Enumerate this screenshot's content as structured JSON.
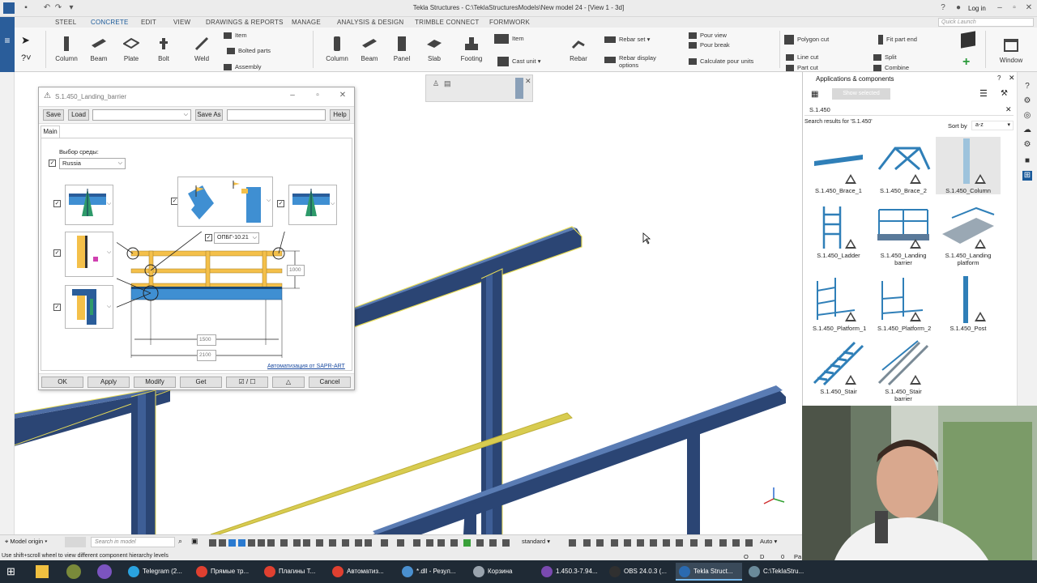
{
  "window": {
    "title": "Tekla Structures - C:\\TeklaStructuresModels\\New model 24 - [View 1 - 3d]",
    "login": "Log in",
    "quick_launch": "Quick Launch"
  },
  "tabs": [
    "STEEL",
    "CONCRETE",
    "EDIT",
    "VIEW",
    "DRAWINGS & REPORTS",
    "MANAGE",
    "ANALYSIS & DESIGN",
    "TRIMBLE CONNECT",
    "FORMWORK"
  ],
  "ribbon": {
    "steel": {
      "column": "Column",
      "beam": "Beam",
      "plate": "Plate",
      "bolt": "Bolt",
      "weld": "Weld",
      "item": "Item",
      "bolted_parts": "Bolted parts",
      "assembly": "Assembly"
    },
    "concrete": {
      "column": "Column",
      "beam": "Beam",
      "panel": "Panel",
      "slab": "Slab",
      "footing": "Footing",
      "item": "Item",
      "cast_unit": "Cast unit",
      "rebar": "Rebar",
      "rebar_set": "Rebar set",
      "rebar_display": "Rebar display options",
      "pour_view": "Pour view",
      "pour_break": "Pour break",
      "calculate_pour": "Calculate pour units"
    },
    "edit": {
      "polygon_cut": "Polygon cut",
      "line_cut": "Line cut",
      "part_cut": "Part cut",
      "fit_part_end": "Fit part end",
      "split": "Split",
      "combine": "Combine"
    },
    "window": "Window"
  },
  "dialog": {
    "title": "S.1.450_Landing_barrier",
    "save": "Save",
    "load": "Load",
    "save_as": "Save As",
    "help": "Help",
    "tab_main": "Main",
    "env_label": "Выбор среды:",
    "env_value": "Russia",
    "profile_value": "ОПБГ-10.21",
    "dim_height": "1000",
    "dim_inner": "1500",
    "dim_outer": "2100",
    "link": "Автоматизация от SAPR-ART",
    "ok": "OK",
    "apply": "Apply",
    "modify": "Modify",
    "get": "Get",
    "toggle": "☑ / ☐",
    "warn": "△",
    "cancel": "Cancel"
  },
  "apps": {
    "title": "Applications & components",
    "show_selected": "Show selected",
    "search_value": "S.1.450",
    "results_label": "Search results for 'S.1.450'",
    "sort_label": "Sort by",
    "sort_value": "a-z",
    "items": [
      "S.1.450_Brace_1",
      "S.1.450_Brace_2",
      "S.1.450_Column",
      "S.1.450_Ladder",
      "S.1.450_Landing barrier",
      "S.1.450_Landing platform",
      "S.1.450_Platform_1",
      "S.1.450_Platform_2",
      "S.1.450_Post",
      "S.1.450_Stair",
      "S.1.450_Stair barrier"
    ]
  },
  "statusbar": {
    "model_origin": "Model origin",
    "search_placeholder": "Search in model",
    "standard": "standard",
    "auto": "Auto",
    "hint": "Use shift+scroll wheel to view different component hierarchy levels",
    "coord_o": "O",
    "coord_d": "D",
    "coord_0": "0",
    "pa": "Pa"
  },
  "taskbar": [
    {
      "label": "Telegram (2...",
      "color": "#2aa3e0"
    },
    {
      "label": "Прямые тр...",
      "color": "#e04030"
    },
    {
      "label": "Плагины Т...",
      "color": "#e04030"
    },
    {
      "label": "Автоматиз...",
      "color": "#e04030"
    },
    {
      "label": "*.dll - Резул...",
      "color": "#4a90d0"
    },
    {
      "label": "Корзина",
      "color": "#9aa4ae"
    },
    {
      "label": "1.450.3-7.94...",
      "color": "#7a4ab0"
    },
    {
      "label": "OBS 24.0.3 (...",
      "color": "#303030"
    },
    {
      "label": "Tekla Struct...",
      "color": "#2a6ab0"
    },
    {
      "label": "C:\\TeklaStru...",
      "color": "#6a8a9a"
    }
  ],
  "colors": {
    "accent": "#1a5a9a",
    "steel_blue": "#2b4574",
    "highlight": "#e8dc58",
    "part_blue": "#3f8fd2",
    "part_yellow": "#f4c04a"
  }
}
